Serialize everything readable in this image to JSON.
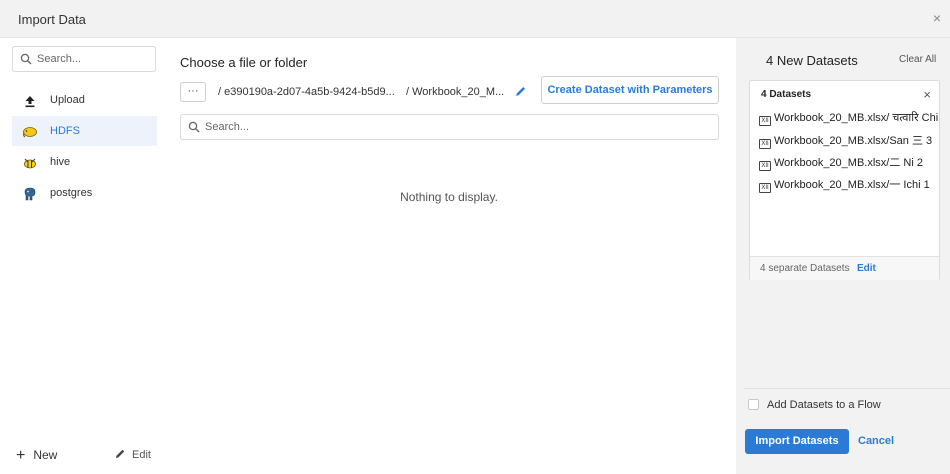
{
  "dialog": {
    "title": "Import Data",
    "close_glyph": "×"
  },
  "sidebar": {
    "search_placeholder": "Search...",
    "items": [
      {
        "label": "Upload",
        "icon": "upload-icon"
      },
      {
        "label": "HDFS",
        "icon": "hdfs-elephant-icon",
        "active": true
      },
      {
        "label": "hive",
        "icon": "hive-bee-icon"
      },
      {
        "label": "postgres",
        "icon": "postgres-elephant-icon"
      }
    ],
    "new_label": "New",
    "new_glyph": "+",
    "edit_label": "Edit"
  },
  "main": {
    "heading": "Choose a file or folder",
    "more_glyph": "···",
    "breadcrumb": [
      "/  e390190a-2d07-4a5b-9424-b5d9...",
      "/  Workbook_20_M..."
    ],
    "param_button": "Create Dataset with Parameters",
    "search_placeholder": "Search...",
    "empty_message": "Nothing to display."
  },
  "right": {
    "title": "4 New Datasets",
    "clear_label": "Clear All",
    "card": {
      "header": "4 Datasets",
      "close_glyph": "×",
      "xl_glyph": "XII",
      "datasets": [
        "Workbook_20_MB.xlsx/ चत्वारि Chi",
        "Workbook_20_MB.xlsx/San 三 3",
        "Workbook_20_MB.xlsx/二 Ni 2",
        "Workbook_20_MB.xlsx/一 Ichi 1"
      ],
      "footer_text": "4 separate Datasets",
      "footer_edit": "Edit"
    },
    "flow_label": "Add Datasets to a Flow",
    "import_label": "Import Datasets",
    "cancel_label": "Cancel"
  },
  "colors": {
    "accent": "#2b7bd6",
    "panel_bg": "#f2f2f2"
  }
}
